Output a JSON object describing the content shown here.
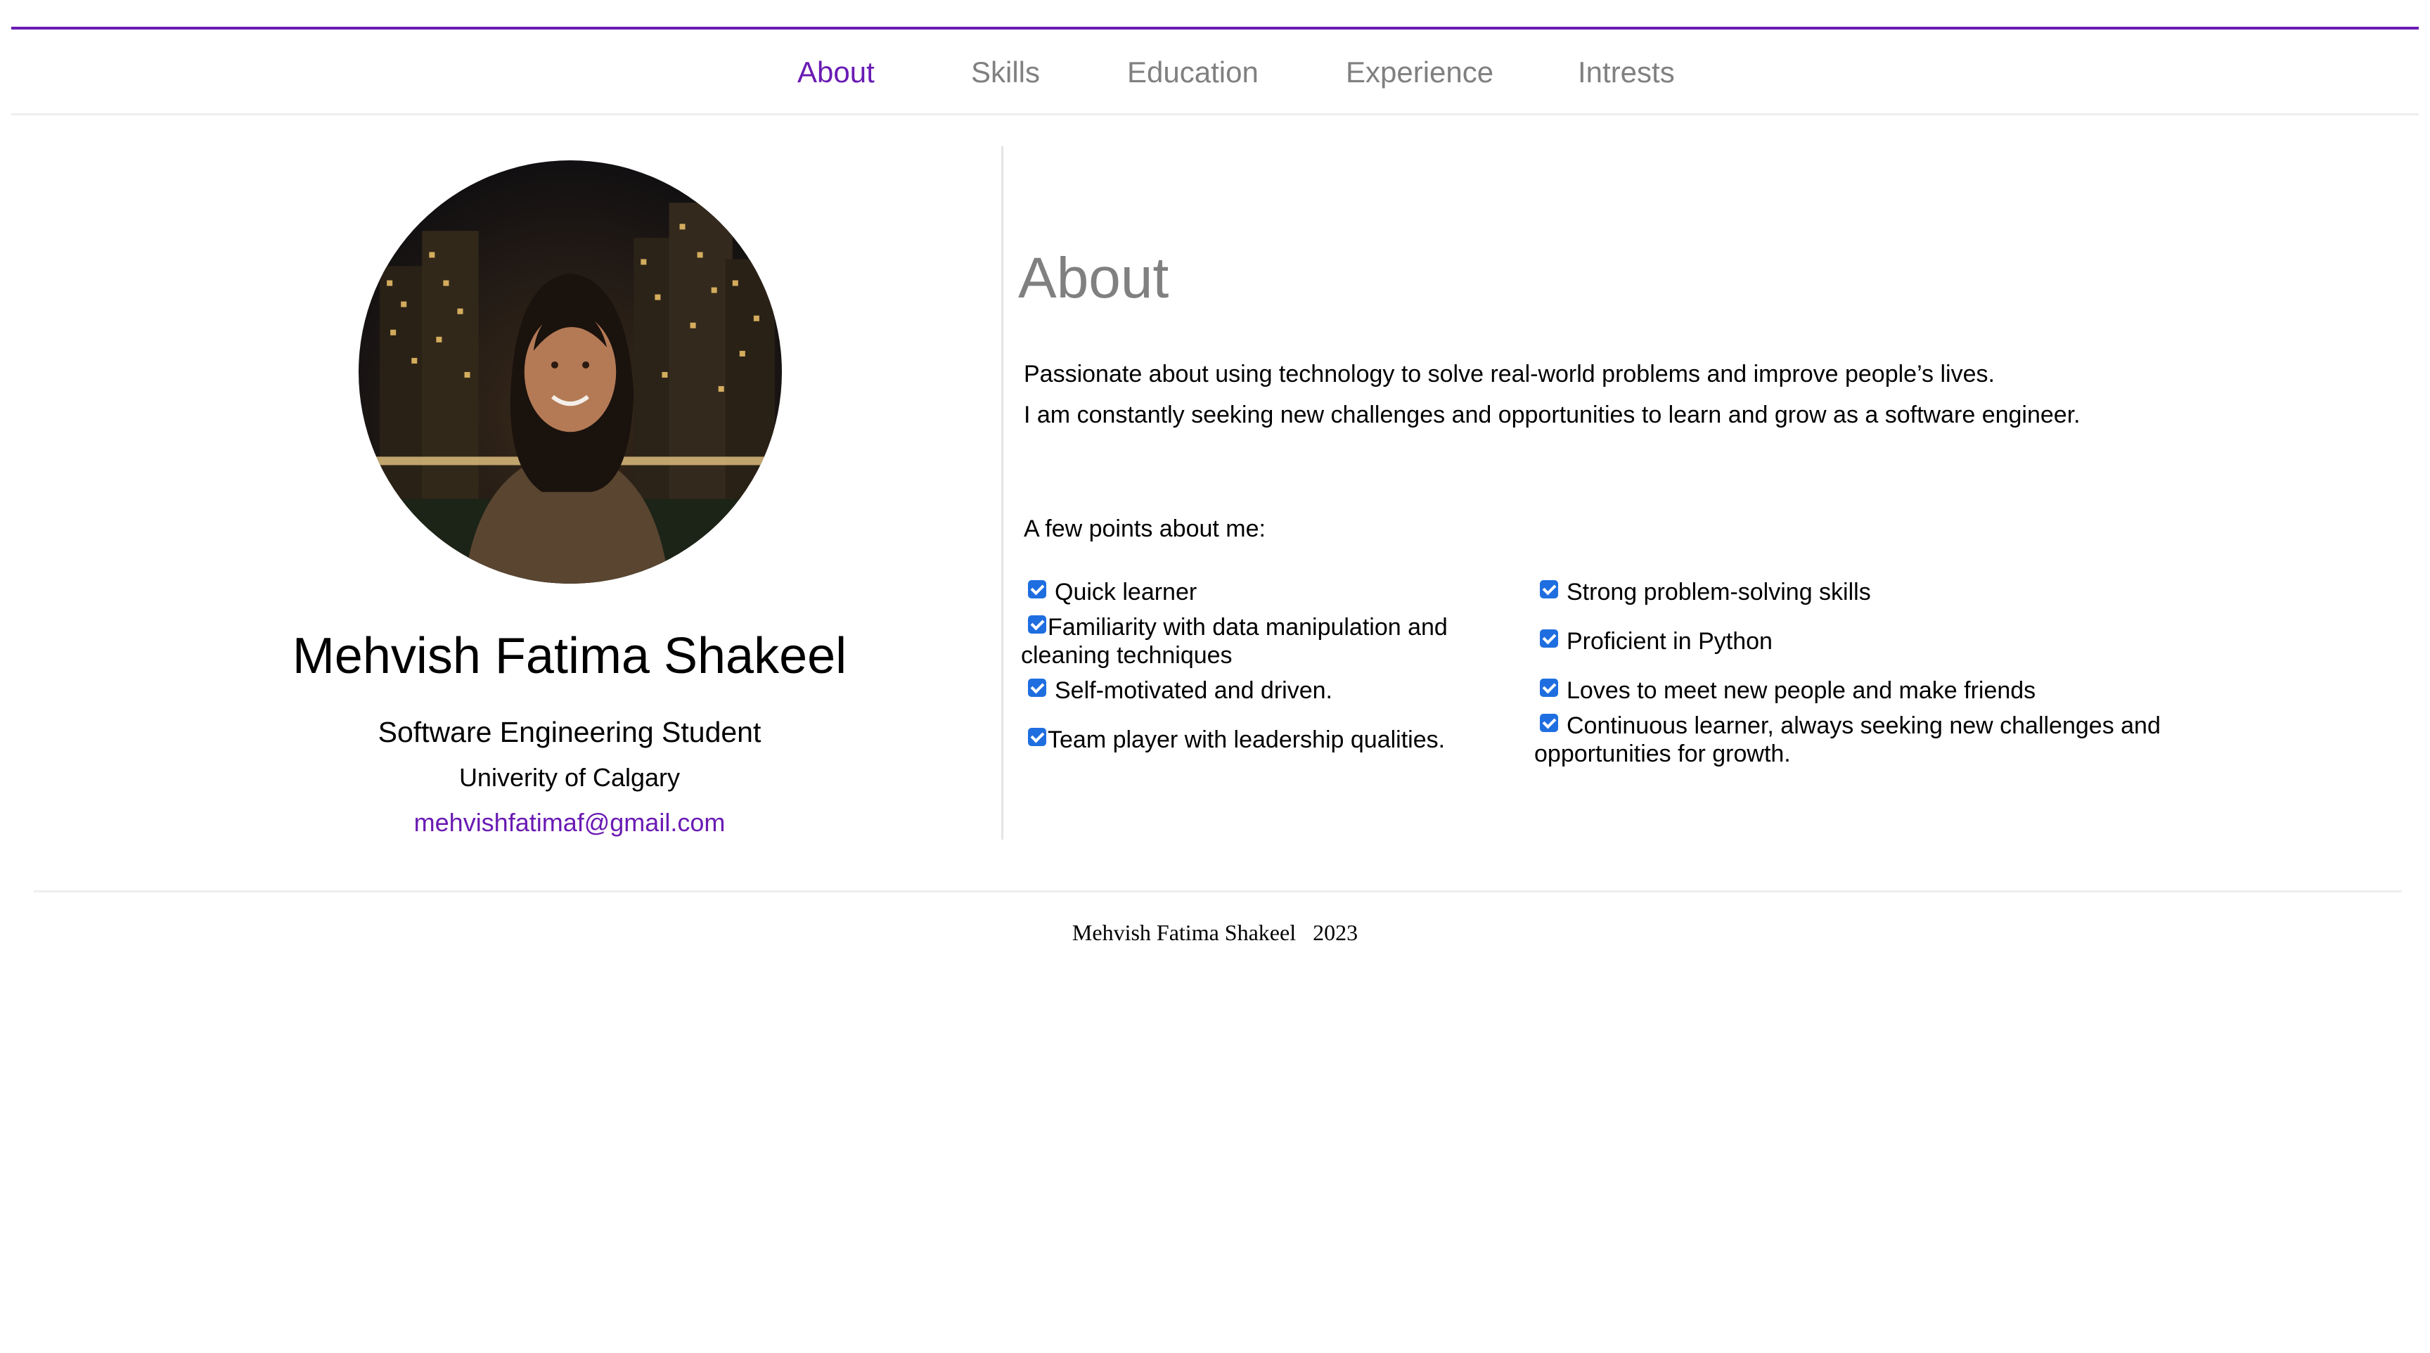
{
  "nav": {
    "items": [
      {
        "label": "About",
        "active": true
      },
      {
        "label": "Skills",
        "active": false
      },
      {
        "label": "Education",
        "active": false
      },
      {
        "label": "Experience",
        "active": false
      },
      {
        "label": "Intrests",
        "active": false
      }
    ]
  },
  "profile": {
    "name": "Mehvish Fatima Shakeel",
    "role": "Software Engineering Student",
    "school": "Univerity of Calgary",
    "email": "mehvishfatimaf@gmail.com"
  },
  "about": {
    "title": "About",
    "paragraphs": [
      "Passionate about using technology to solve real-world problems and improve people’s lives.",
      "I am constantly seeking new challenges and opportunities to learn and grow as a software engineer."
    ],
    "points_label": "A few points about me:",
    "points": [
      {
        "text": "Quick learner",
        "checked": true
      },
      {
        "text": "Strong problem-solving skills",
        "checked": true
      },
      {
        "text": "Familiarity with data manipulation and cleaning techniques",
        "checked": true
      },
      {
        "text": "Proficient in Python",
        "checked": true
      },
      {
        "text": "Self-motivated and driven.",
        "checked": true
      },
      {
        "text": "Loves to meet new people and make friends",
        "checked": true
      },
      {
        "text": "Team player with leadership qualities.",
        "checked": true
      },
      {
        "text": "Continuous learner, always seeking new challenges and opportunities for growth.",
        "checked": true
      }
    ]
  },
  "footer": {
    "text": "Mehvish Fatima Shakeel   2023"
  },
  "colors": {
    "accent": "#6a1bb3",
    "muted": "#808080",
    "checkbox": "#1f6ee0"
  }
}
